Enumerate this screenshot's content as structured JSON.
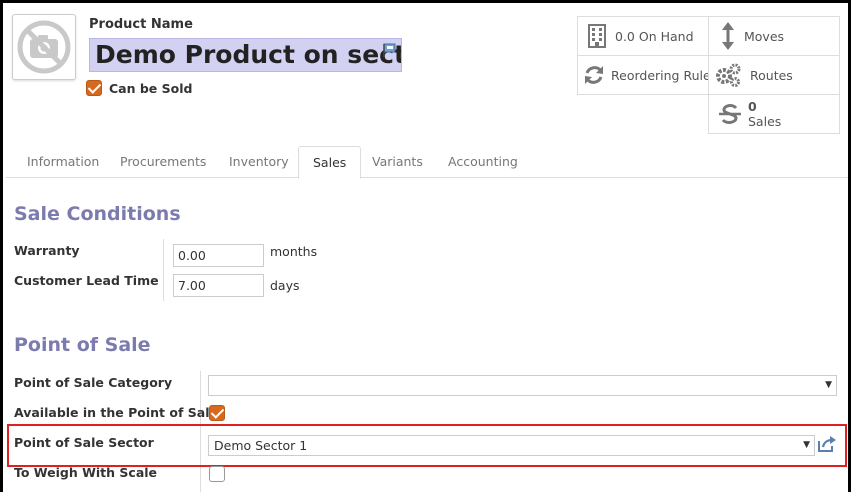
{
  "product": {
    "name_label": "Product Name",
    "name_value": "Demo Product on sector",
    "can_be_sold_label": "Can be Sold",
    "can_be_sold": true
  },
  "stats": {
    "on_hand": "0.0 On Hand",
    "moves": "Moves",
    "reordering": "Reordering Rules",
    "routes": "Routes",
    "sales_count": "0",
    "sales_label": "Sales"
  },
  "tabs": [
    {
      "label": "Information"
    },
    {
      "label": "Procurements"
    },
    {
      "label": "Inventory"
    },
    {
      "label": "Sales"
    },
    {
      "label": "Variants"
    },
    {
      "label": "Accounting"
    }
  ],
  "active_tab": "Sales",
  "sale_conditions": {
    "title": "Sale Conditions",
    "warranty_label": "Warranty",
    "warranty_value": "0.00",
    "warranty_unit": "months",
    "lead_time_label": "Customer Lead Time",
    "lead_time_value": "7.00",
    "lead_time_unit": "days"
  },
  "pos": {
    "title": "Point of Sale",
    "category_label": "Point of Sale Category",
    "category_value": "",
    "available_label": "Available in the Point of Sale",
    "available": true,
    "sector_label": "Point of Sale Sector",
    "sector_value": "Demo Sector 1",
    "weigh_label": "To Weigh With Scale",
    "weigh": false
  },
  "colors": {
    "accent_title": "#7c7bad",
    "checkbox": "#d6691e",
    "highlight": "#e02020",
    "name_bg": "#d3d1f2"
  }
}
